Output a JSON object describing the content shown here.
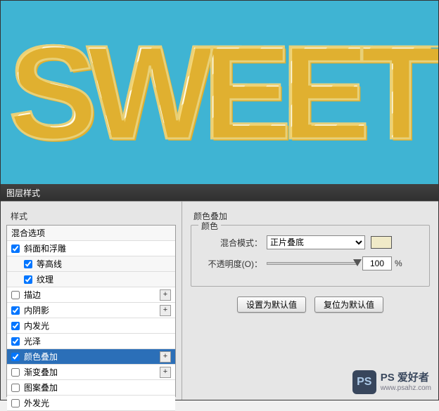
{
  "preview": {
    "text": "SWEET"
  },
  "dialog": {
    "title": "图层样式"
  },
  "styles_panel": {
    "header": "样式",
    "blend_options": "混合选项",
    "items": [
      {
        "label": "斜面和浮雕",
        "checked": true,
        "hasPlus": false,
        "sub": false
      },
      {
        "label": "等高线",
        "checked": true,
        "hasPlus": false,
        "sub": true
      },
      {
        "label": "纹理",
        "checked": true,
        "hasPlus": false,
        "sub": true
      },
      {
        "label": "描边",
        "checked": false,
        "hasPlus": true,
        "sub": false
      },
      {
        "label": "内阴影",
        "checked": true,
        "hasPlus": true,
        "sub": false
      },
      {
        "label": "内发光",
        "checked": true,
        "hasPlus": false,
        "sub": false
      },
      {
        "label": "光泽",
        "checked": true,
        "hasPlus": false,
        "sub": false
      },
      {
        "label": "颜色叠加",
        "checked": true,
        "hasPlus": true,
        "sub": false,
        "selected": true
      },
      {
        "label": "渐变叠加",
        "checked": false,
        "hasPlus": true,
        "sub": false
      },
      {
        "label": "图案叠加",
        "checked": false,
        "hasPlus": false,
        "sub": false
      },
      {
        "label": "外发光",
        "checked": false,
        "hasPlus": false,
        "sub": false
      }
    ]
  },
  "options": {
    "title": "颜色叠加",
    "fieldset_label": "颜色",
    "blend_mode_label": "混合模式：",
    "blend_mode_value": "正片叠底",
    "opacity_label": "不透明度(O)：",
    "opacity_value": "100",
    "opacity_unit": "%",
    "set_default": "设置为默认值",
    "reset_default": "复位为默认值",
    "color_swatch": "#f0eac8"
  },
  "watermark": {
    "logo": "PS",
    "line1": "PS 爱好者",
    "line2": "www.psahz.com"
  }
}
